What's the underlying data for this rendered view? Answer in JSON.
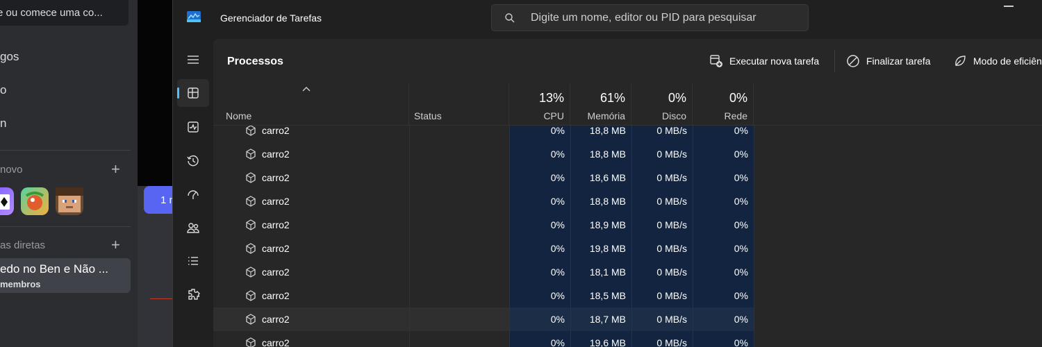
{
  "discord": {
    "search_text": "e ou comece uma co...",
    "nav": [
      "gos",
      "o",
      "n"
    ],
    "section_new": "novo",
    "section_dm": "as diretas",
    "dm_name": "edo no Ben e Não ...",
    "dm_sub": "membros",
    "pill_text": "1 n"
  },
  "taskmanager": {
    "title": "Gerenciador de Tarefas",
    "search_placeholder": "Digite um nome, editor ou PID para pesquisar",
    "page_title": "Processos",
    "toolbar": {
      "run_new_task": "Executar nova tarefa",
      "end_task": "Finalizar tarefa",
      "efficiency_mode": "Modo de eficiên"
    },
    "columns": {
      "name": "Nome",
      "status": "Status",
      "cpu": {
        "label": "CPU",
        "percent": "13%"
      },
      "memory": {
        "label": "Memória",
        "percent": "61%"
      },
      "disk": {
        "label": "Disco",
        "percent": "0%"
      },
      "network": {
        "label": "Rede",
        "percent": "0%"
      }
    },
    "rows": [
      {
        "name": "carro2",
        "cpu": "0%",
        "memory": "18,8 MB",
        "disk": "0 MB/s",
        "network": "0%"
      },
      {
        "name": "carro2",
        "cpu": "0%",
        "memory": "18,8 MB",
        "disk": "0 MB/s",
        "network": "0%"
      },
      {
        "name": "carro2",
        "cpu": "0%",
        "memory": "18,6 MB",
        "disk": "0 MB/s",
        "network": "0%"
      },
      {
        "name": "carro2",
        "cpu": "0%",
        "memory": "18,8 MB",
        "disk": "0 MB/s",
        "network": "0%"
      },
      {
        "name": "carro2",
        "cpu": "0%",
        "memory": "18,9 MB",
        "disk": "0 MB/s",
        "network": "0%"
      },
      {
        "name": "carro2",
        "cpu": "0%",
        "memory": "19,8 MB",
        "disk": "0 MB/s",
        "network": "0%"
      },
      {
        "name": "carro2",
        "cpu": "0%",
        "memory": "18,1 MB",
        "disk": "0 MB/s",
        "network": "0%"
      },
      {
        "name": "carro2",
        "cpu": "0%",
        "memory": "18,5 MB",
        "disk": "0 MB/s",
        "network": "0%"
      },
      {
        "name": "carro2",
        "cpu": "0%",
        "memory": "18,7 MB",
        "disk": "0 MB/s",
        "network": "0%"
      },
      {
        "name": "carro2",
        "cpu": "0%",
        "memory": "19,6 MB",
        "disk": "0 MB/s",
        "network": "0%"
      }
    ],
    "icons": {
      "nav": [
        "hamburger-icon",
        "processes-icon",
        "performance-icon",
        "app-history-icon",
        "startup-apps-icon",
        "users-icon",
        "details-icon",
        "services-icon"
      ]
    },
    "colors": {
      "accent": "#4cc2ff",
      "heat_cell": "#12243f"
    }
  }
}
